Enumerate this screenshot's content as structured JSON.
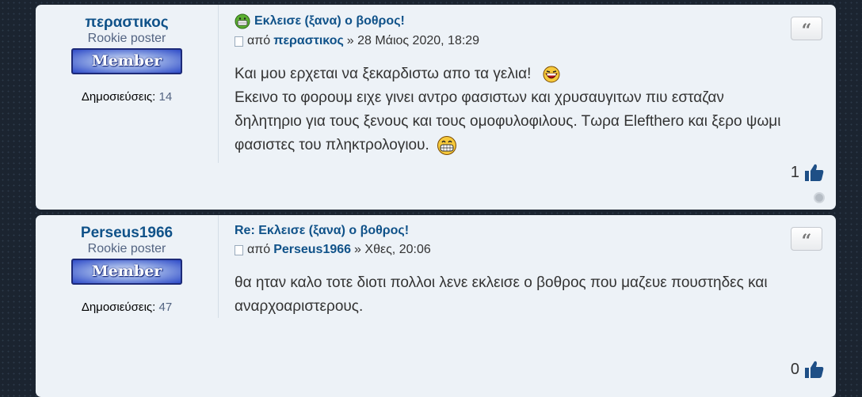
{
  "posts": [
    {
      "username": "περαστικος",
      "rank": "Rookie poster",
      "rank_badge": "Member",
      "posts_label": "Δημοσιεύσεις:",
      "posts_count": "14",
      "title": "Εκλεισε (ξανα) ο βοθρος!",
      "by_prefix": "από",
      "author": "περαστικος",
      "date": "» 28 Μάιος 2020, 18:29",
      "lines": [
        "Και μου ερχεται να ξεκαρδιστω απο τα γελια!",
        "Εκεινο το φορουμ ειχε γινει αντρο φασιστων και χρυσαυγιτων πιυ εσταζαν",
        "δηλητηριο για τους ξενους και τους ομοφυλοφιλους. Τωρα Elefthero και ξερο ψωμι",
        "φασιστες του πληκτρολογιου."
      ],
      "likes": "1"
    },
    {
      "username": "Perseus1966",
      "rank": "Rookie poster",
      "rank_badge": "Member",
      "posts_label": "Δημοσιεύσεις:",
      "posts_count": "47",
      "title": "Re: Εκλεισε (ξανα) ο βοθρος!",
      "by_prefix": "από",
      "author": "Perseus1966",
      "date": "» Χθες, 20:06",
      "lines": [
        "θα ηταν καλο τοτε διοτι πολλοι λενε εκλεισε ο βοθρος που μαζευε πουστηδες και",
        "αναρχοαριστερους."
      ],
      "likes": "0"
    }
  ],
  "quote_glyph": "“",
  "colors": {
    "link": "#105289",
    "panel": "#edf2f7"
  },
  "icons": [
    "quote-icon",
    "thumbs-up-icon",
    "laughing-smiley-icon",
    "grin-smiley-icon",
    "post-document-icon",
    "online-status-icon"
  ]
}
